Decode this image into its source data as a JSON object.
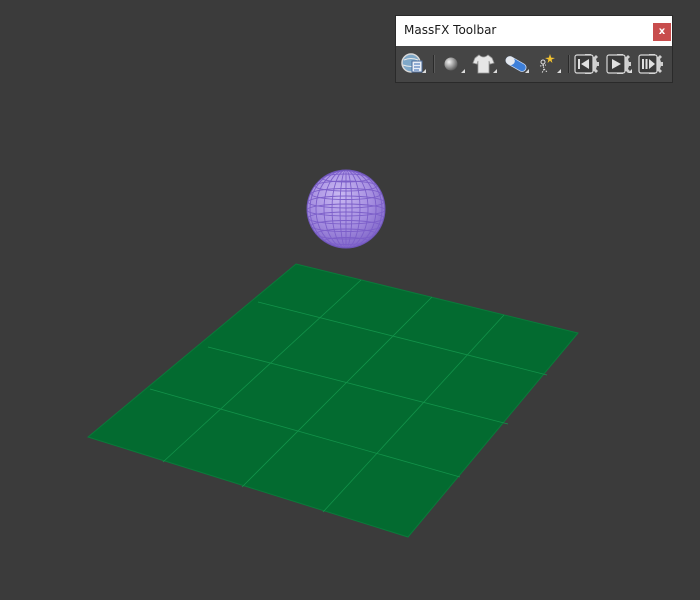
{
  "window": {
    "title": "MassFX Toolbar",
    "close_label": "x"
  },
  "toolbar": {
    "buttons": [
      {
        "name": "world-parameters-button",
        "icon": "world-settings-icon",
        "flyout": true
      },
      {
        "name": "rigid-body-button",
        "icon": "sphere-icon",
        "flyout": true
      },
      {
        "name": "mcloth-button",
        "icon": "shirt-icon",
        "flyout": true
      },
      {
        "name": "constraint-button",
        "icon": "capsule-icon",
        "flyout": true
      },
      {
        "name": "ragdoll-button",
        "icon": "skeleton-sparkle-icon",
        "flyout": true
      },
      {
        "name": "reset-simulation-button",
        "icon": "rewind-gear-icon",
        "flyout": false
      },
      {
        "name": "play-simulation-button",
        "icon": "play-gear-icon",
        "flyout": true
      },
      {
        "name": "step-simulation-button",
        "icon": "step-gear-icon",
        "flyout": false
      }
    ]
  },
  "scene": {
    "background_color": "#3b3b3b",
    "plane_color": "#036b30",
    "plane_grid_color": "#0f8a44",
    "sphere_color": "#a58ee0",
    "sphere_wire_color": "#7c5fc9"
  }
}
